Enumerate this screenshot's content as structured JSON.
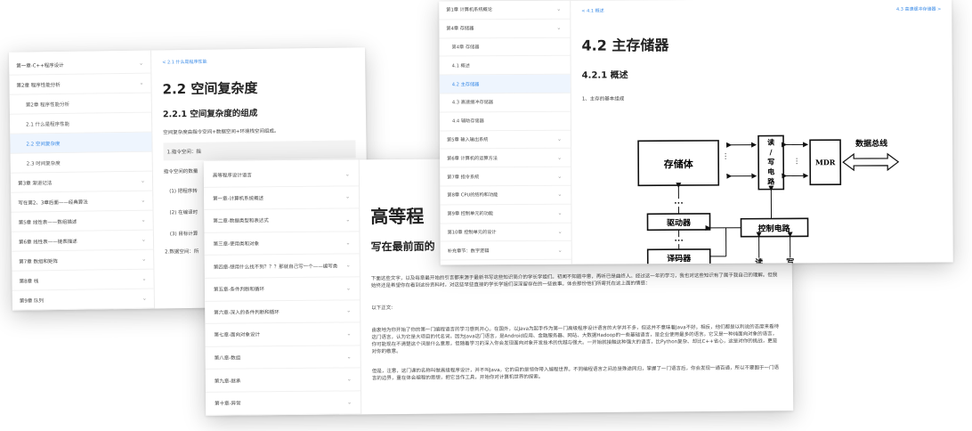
{
  "win_left": {
    "sidebar": [
      {
        "label": "第一章-C++程序设计",
        "type": "chapter"
      },
      {
        "label": "第2章 程序性能分析",
        "type": "chapter"
      },
      {
        "label": "第2章 程序性能分析",
        "type": "sub"
      },
      {
        "label": "2.1 什么是程序性能",
        "type": "sub"
      },
      {
        "label": "2.2 空间复杂度",
        "type": "active"
      },
      {
        "label": "2.3 时间复杂度",
        "type": "sub"
      },
      {
        "label": "第3章 渐进记法",
        "type": "chapter"
      },
      {
        "label": "写在第2、3章后面——经典算法",
        "type": "chapter"
      },
      {
        "label": "第5章 线性表——数组描述",
        "type": "chapter"
      },
      {
        "label": "第6章 线性表——链表描述",
        "type": "chapter"
      },
      {
        "label": "第7章 数组和矩阵",
        "type": "chapter"
      },
      {
        "label": "第8章 栈",
        "type": "chapter"
      },
      {
        "label": "第9章 队列",
        "type": "chapter"
      }
    ],
    "crumb_prev": "< 2.1 什么是程序性能",
    "title": "2.2 空间复杂度",
    "subtitle": "2.2.1 空间复杂度的组成",
    "p1": "空间复杂度由指令空间+数据空间+环境栈空间组成。",
    "list1": "1.指令空间：指",
    "p2": "指令空间的数量",
    "li1": "(1) 把程序转",
    "li2": "(2) 在编译时",
    "li3": "(3) 目标计算",
    "p3": "2.数据空间：所"
  },
  "win_mid": {
    "sidebar": [
      "高等程序设计语言",
      "第一章-计算机系统概述",
      "第二章-数据类型和表达式",
      "第三章-使用类和对象",
      "第四章-想用什么找不到？？？那就自己写一个——编写类",
      "第五章-条件判断和循环",
      "第六章-深入的条件判断和循环",
      "第七章-面向对象设计",
      "第八章-数组",
      "第九章-继承",
      "第十章-异常"
    ],
    "title": "高等程",
    "subtitle": "写在最前面的",
    "p1": "下面这些文字，以及每章最开始的引言都来源于最新书写这些知识简介的学长学姐们。初闻不知题中意，再听已是曲终人。经过这一年的学习，我也对这些知识有了属于我自己的理解。但我始终还是希望你在看到这份资料时，对这些早些直接的学长学姐们深深留存在的一些故事。体会那份他们所寄托在这上面的情感：",
    "p2": "以下正文:",
    "p3": "由衷地为你开始了你的第一门编程语言的学习感到开心。在国外，以Java为起手作为第一门高级程序设计语言的大学并不多，但这并不意味着Java不好。相反，他们都是以利说的态度来看待这门语言，认为它是大项目的代名词，因为Java这门语言，是Android应用、金融服务器、网站、大数据Hadoop的一些基础语言，是企业使用最多的语言。它又是一种纯面向对象的语言，你可能现在不清楚这个词是什么意思，但随着学习的深入你会发现面向对象开发技术的优越与强大。一开始就接触这种强大的语言，比Python复杂、却比C++省心，这是对你的挑战，更是对你的敬意。",
    "p4": "但是，注意，这门课的名称叫做高级程序设计，并不叫Java。它的目的是领你带入编程世界。不同编程语言之间总是殊途同归，掌握了一门语言后，你会发现一通百通，所以不要囿于一门语言的边界，重在体会编程的思想，把它当作工具，开始你对计算机世界的探索。"
  },
  "win_right": {
    "sidebar": [
      {
        "label": "第1章 计算机系统概论",
        "type": "chapter"
      },
      {
        "label": "第4章 存储器",
        "type": "chapter"
      },
      {
        "label": "第4章 存储器",
        "type": "sub"
      },
      {
        "label": "4.1 概述",
        "type": "sub"
      },
      {
        "label": "4.2 主存储器",
        "type": "active"
      },
      {
        "label": "4.3 高速缓冲存储器",
        "type": "sub"
      },
      {
        "label": "4.4 辅助存储器",
        "type": "sub"
      },
      {
        "label": "第5章 输入输出系统",
        "type": "chapter"
      },
      {
        "label": "第6章 计算机的运算方法",
        "type": "chapter"
      },
      {
        "label": "第7章 指令系统",
        "type": "chapter"
      },
      {
        "label": "第8章 CPU的结构和功能",
        "type": "chapter"
      },
      {
        "label": "第9章 控制单元的功能",
        "type": "chapter"
      },
      {
        "label": "第10章 控制单元的设计",
        "type": "chapter"
      },
      {
        "label": "补充章节：数字逻辑",
        "type": "chapter"
      }
    ],
    "crumb_prev": "< 4.1 概述",
    "crumb_next": "4.3 高速缓冲存储器 >",
    "title": "4.2 主存储器",
    "subtitle": "4.2.1 概述",
    "p1": "1、主存的基本组成",
    "diagram": {
      "storage": "存储体",
      "rw": "读/写电路",
      "rw_chars": [
        "读",
        "/",
        "写",
        "电",
        "路"
      ],
      "mdr": "MDR",
      "bus": "数据总线",
      "driver": "驱动器",
      "decoder": "译码器",
      "control": "控制电路",
      "read": "读",
      "write": "写",
      "dots": "•••"
    }
  }
}
